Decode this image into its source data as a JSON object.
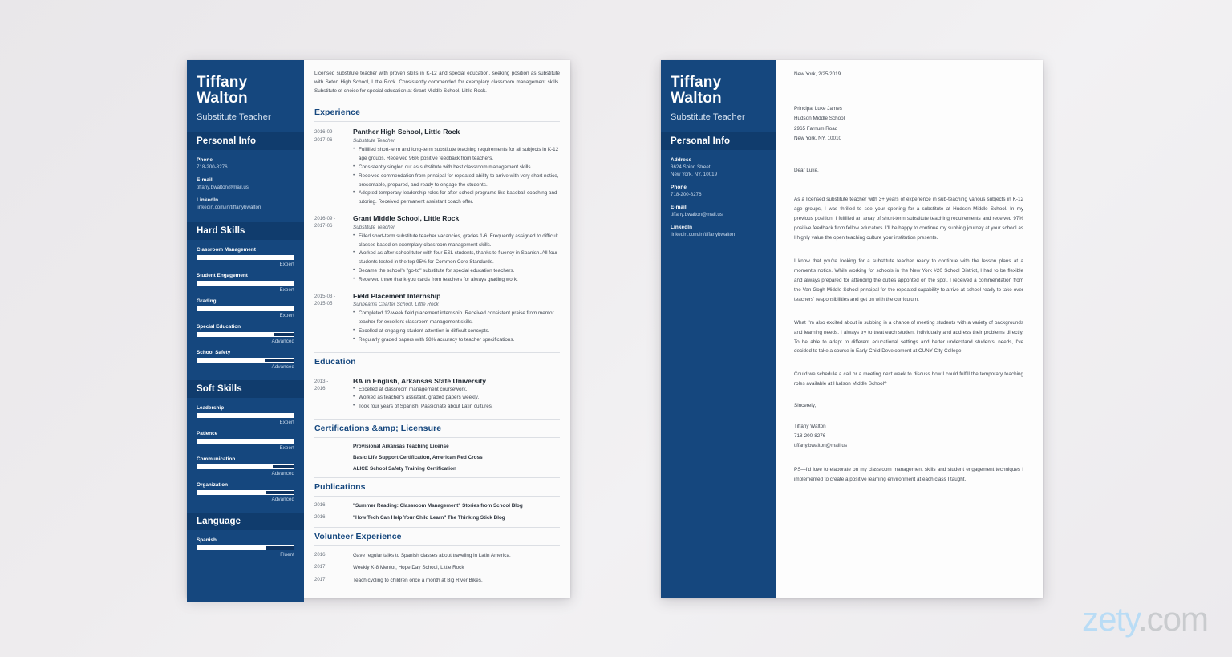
{
  "background": {
    "gradient_from": "#e9e7ea",
    "gradient_to": "#f2f1f3"
  },
  "theme": {
    "navy": "#15477e",
    "navy_dark": "#103c6d",
    "heading": "#15477e",
    "body_text": "#3f4650"
  },
  "watermark": {
    "brand": "zety",
    "tld": ".com",
    "brand_color": "#b9dcf5",
    "tld_color": "#c9cbce"
  },
  "resume": {
    "sidebar": {
      "first_name": "Tiffany",
      "last_name": "Walton",
      "job_title": "Substitute Teacher",
      "personal_info_heading": "Personal Info",
      "personal_info": [
        {
          "label": "Phone",
          "value": "718-200-8276"
        },
        {
          "label": "E-mail",
          "value": "tiffany.bwalton@mail.us"
        },
        {
          "label": "LinkedIn",
          "value": "linkedin.com/in/tiffanybwalton"
        }
      ],
      "hard_skills_heading": "Hard Skills",
      "hard_skills": [
        {
          "name": "Classroom Management",
          "level": "Expert",
          "pct": 100
        },
        {
          "name": "Student Engagement",
          "level": "Expert",
          "pct": 100
        },
        {
          "name": "Grading",
          "level": "Expert",
          "pct": 100
        },
        {
          "name": "Special Education",
          "level": "Advanced",
          "pct": 80
        },
        {
          "name": "School Safety",
          "level": "Advanced",
          "pct": 70
        }
      ],
      "soft_skills_heading": "Soft Skills",
      "soft_skills": [
        {
          "name": "Leadership",
          "level": "Expert",
          "pct": 100
        },
        {
          "name": "Patience",
          "level": "Expert",
          "pct": 100
        },
        {
          "name": "Communication",
          "level": "Advanced",
          "pct": 78
        },
        {
          "name": "Organization",
          "level": "Advanced",
          "pct": 72
        }
      ],
      "language_heading": "Language",
      "languages": [
        {
          "name": "Spanish",
          "level": "Fluent",
          "pct": 72
        }
      ]
    },
    "summary": "Licensed substitute teacher with proven skills in K-12 and special education, seeking position as substitute with Seton High School, Little Rock. Consistently commended for exemplary classroom management skills. Substitute of choice for special education at Grant Middle School, Little Rock.",
    "experience_heading": "Experience",
    "experience": [
      {
        "date": "2016-09 - 2017-06",
        "title": "Panther High School, Little Rock",
        "subtitle": "Substitute Teacher",
        "bullets": [
          "Fulfilled short-term and long-term substitute teaching requirements for all subjects in K-12 age groups. Received 96% positive feedback from teachers.",
          "Consistently singled out as substitute with best classroom management skills.",
          "Received commendation from principal for repeated ability to arrive with very short notice, presentable, prepared, and ready to engage the students.",
          "Adopted temporary leadership roles for after-school programs like baseball coaching and tutoring. Received permanent assistant coach offer."
        ]
      },
      {
        "date": "2016-09 - 2017-06",
        "title": "Grant Middle School, Little Rock",
        "subtitle": "Substitute Teacher",
        "bullets": [
          "Filled short-term substitute teacher vacancies, grades 1-6. Frequently assigned to difficult classes based on exemplary classroom management skills.",
          "Worked as after-school tutor with four ESL students, thanks to fluency in Spanish. All four students tested in the top 95% for Common Core Standards.",
          "Became the school's \"go-to\" substitute for special education teachers.",
          "Received three thank-you cards from teachers for always grading work."
        ]
      },
      {
        "date": "2015-03 - 2015-05",
        "title": "Field Placement Internship",
        "subtitle": "Sunbeams Charter School, Little Rock",
        "bullets": [
          "Completed 12-week field placement internship. Received consistent praise from mentor teacher for excellent classroom management skills.",
          "Excelled at engaging student attention in difficult concepts.",
          "Regularly graded papers with 98% accuracy to teacher specifications."
        ]
      }
    ],
    "education_heading": "Education",
    "education": [
      {
        "date": "2013 - 2016",
        "title": "BA in English, Arkansas State University",
        "bullets": [
          "Excelled at classroom management coursework.",
          "Worked as teacher's assistant, graded papers weekly.",
          "Took four years of Spanish. Passionate about Latin cultures."
        ]
      }
    ],
    "certifications_heading": "Certifications &amp; Licensure",
    "certifications": [
      "Provisional Arkansas Teaching License",
      "Basic Life Support Certification, American Red Cross",
      "ALICE School Safety Training Certification"
    ],
    "publications_heading": "Publications",
    "publications": [
      {
        "date": "2016",
        "text": "\"Summer Reading: Classroom Management\" Stories from School Blog"
      },
      {
        "date": "2016",
        "text": "\"How Tech Can Help Your Child Learn\" The Thinking Stick Blog"
      }
    ],
    "volunteer_heading": "Volunteer Experience",
    "volunteer": [
      {
        "date": "2016",
        "text": "Gave regular talks to Spanish classes about traveling in Latin America."
      },
      {
        "date": "2017",
        "text": "Weekly K-8 Mentor, Hope Day School, Little Rock"
      },
      {
        "date": "2017",
        "text": "Teach cycling to children once a month at Big River Bikes."
      }
    ]
  },
  "cover_letter": {
    "sidebar": {
      "first_name": "Tiffany",
      "last_name": "Walton",
      "job_title": "Substitute Teacher",
      "personal_info_heading": "Personal Info",
      "personal_info": [
        {
          "label": "Address",
          "value": "3624 Shinn Street\nNew York, NY, 10019"
        },
        {
          "label": "Phone",
          "value": "718-200-8276"
        },
        {
          "label": "E-mail",
          "value": "tiffany.bwalton@mail.us"
        },
        {
          "label": "LinkedIn",
          "value": "linkedin.com/in/tiffanybwalton"
        }
      ]
    },
    "date_line": "New York, 2/25/2019",
    "recipient": "Principal Luke James\nHudson Middle School\n2965 Farnum Road\nNew York, NY, 10010",
    "greeting": "Dear Luke,",
    "paragraphs": [
      "As a licensed substitute teacher with 3+ years of experience in sub-teaching various subjects in K-12 age groups, I was thrilled to see your opening for a substitute at Hudson Middle School. In my previous position, I fulfilled an array of short-term substitute teaching requirements and received 97% positive feedback from fellow educators. I'll be happy to continue my subbing journey at your school as I highly value the open teaching culture your institution presents.",
      "I know that you're looking for a substitute teacher ready to continue with the lesson plans at a moment's notice. While working for schools in the New York #20 School District, I had to be flexible and always prepared for attending the duties apponted on the spot. I received a commendation from the Van Gogh Middle School principal for the repeated capability to arrive at school ready to take over teachers' responsibilities and get on with the curriculum.",
      "What I'm also excited about in subbing is a chance of meeting students with a variety of backgrounds and learning needs. I always try to treat each student individually and address their problems directly. To be able to adapt to different educational settings and better understand students' needs, I've decided to take a course in Early Child Development at CUNY City College.",
      "Could we schedule a call or a meeting next week to discuss how I could fulfill the temporary teaching roles available at Hudson Middle School?"
    ],
    "signoff": "Sincerely,",
    "signature": "Tiffany Walton\n718-200-8276\ntiffany.bwalton@mail.us",
    "postscript": "PS—I'd love to elaborate on my classroom management skills and student engagement techniques I implemented to create a positive learning environment at each class I taught."
  }
}
